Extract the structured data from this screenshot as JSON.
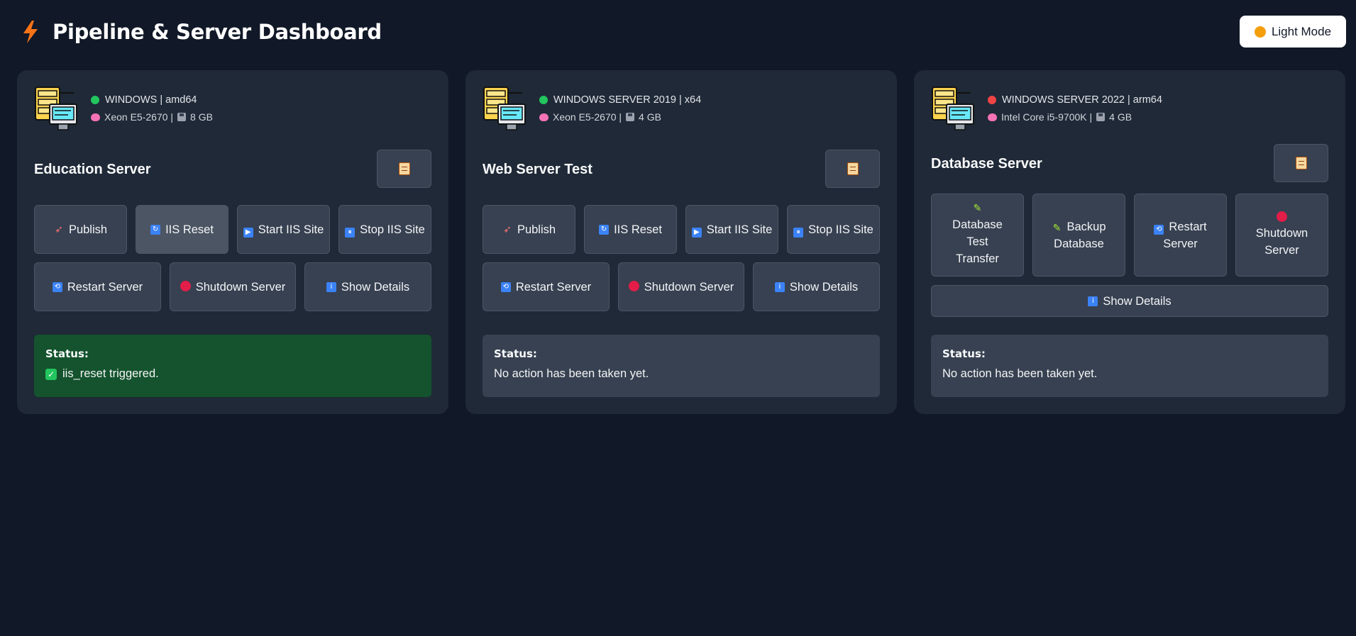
{
  "header": {
    "title": "Pipeline & Server Dashboard",
    "mode_button_label": "Light Mode"
  },
  "colors": {
    "background": "#111827",
    "card": "#1f2937",
    "online": "#22c55e",
    "offline": "#ef4444",
    "success_status": "#14532d"
  },
  "servers": [
    {
      "name": "Education Server",
      "status_dot": "online",
      "os_line": "WINDOWS | amd64",
      "cpu": "Xeon E5-2670 |",
      "ram": "8 GB",
      "buttons": [
        "Publish",
        "IIS Reset",
        "Start IIS Site",
        "Stop IIS Site",
        "Restart Server",
        "Shutdown Server",
        "Show Details"
      ],
      "status_label": "Status:",
      "status_text": "iis_reset triggered."
    },
    {
      "name": "Web Server Test",
      "status_dot": "online",
      "os_line": "WINDOWS SERVER 2019 | x64",
      "cpu": "Xeon E5-2670 |",
      "ram": "4 GB",
      "buttons": [
        "Publish",
        "IIS Reset",
        "Start IIS Site",
        "Stop IIS Site",
        "Restart Server",
        "Shutdown Server",
        "Show Details"
      ],
      "status_label": "Status:",
      "status_text": "No action has been taken yet."
    },
    {
      "name": "Database Server",
      "status_dot": "offline",
      "os_line": "WINDOWS SERVER 2022 | arm64",
      "cpu": "Intel Core i5-9700K |",
      "ram": "4 GB",
      "buttons": [
        "Database Test Transfer",
        "Backup Database",
        "Restart Server",
        "Shutdown Server",
        "Show Details"
      ],
      "status_label": "Status:",
      "status_text": "No action has been taken yet."
    }
  ]
}
